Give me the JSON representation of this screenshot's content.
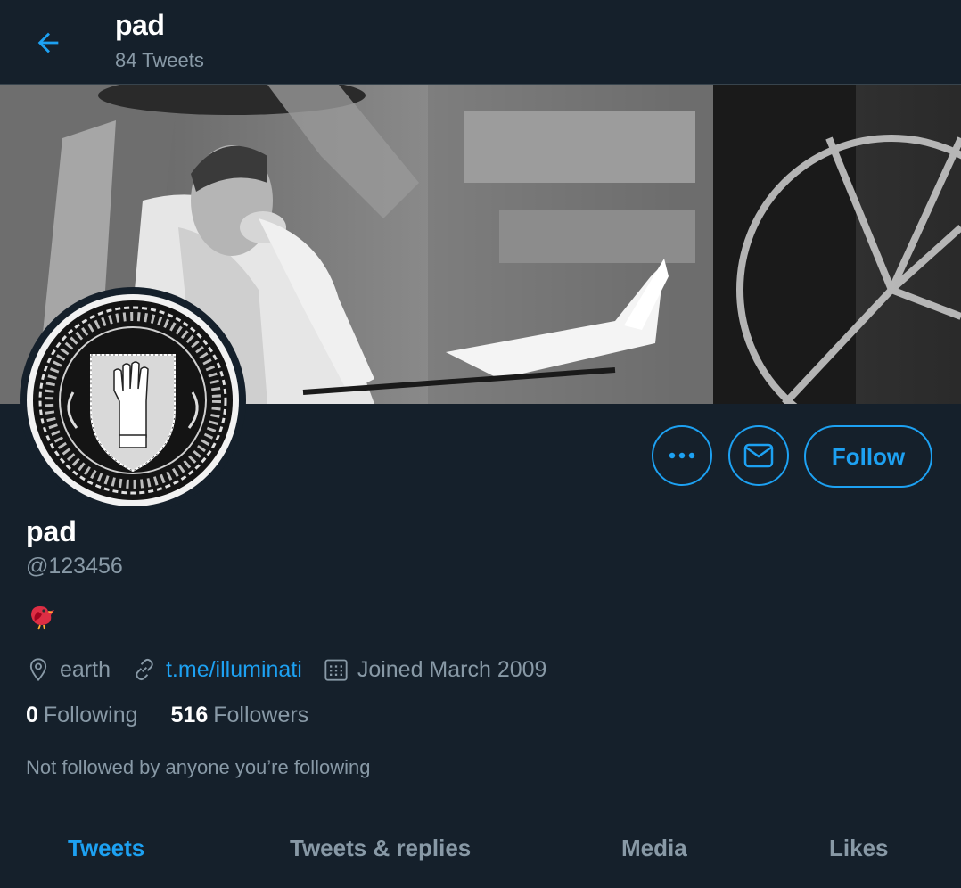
{
  "header": {
    "title": "pad",
    "tweet_count": "84 Tweets"
  },
  "profile": {
    "display_name": "pad",
    "handle": "@123456",
    "bio_emoji": "red-bird-emoji",
    "location": "earth",
    "website": "t.me/illuminati",
    "joined": "Joined March 2009",
    "following_count": "0",
    "following_label": "Following",
    "followers_count": "516",
    "followers_label": "Followers",
    "not_followed_text": "Not followed by anyone you’re following"
  },
  "actions": {
    "follow_label": "Follow"
  },
  "tabs": [
    {
      "label": "Tweets",
      "active": true
    },
    {
      "label": "Tweets & replies",
      "active": false
    },
    {
      "label": "Media",
      "active": false
    },
    {
      "label": "Likes",
      "active": false
    }
  ],
  "colors": {
    "background": "#15202b",
    "accent": "#1da1f2",
    "secondary_text": "#8899a6",
    "border": "#38444d"
  }
}
